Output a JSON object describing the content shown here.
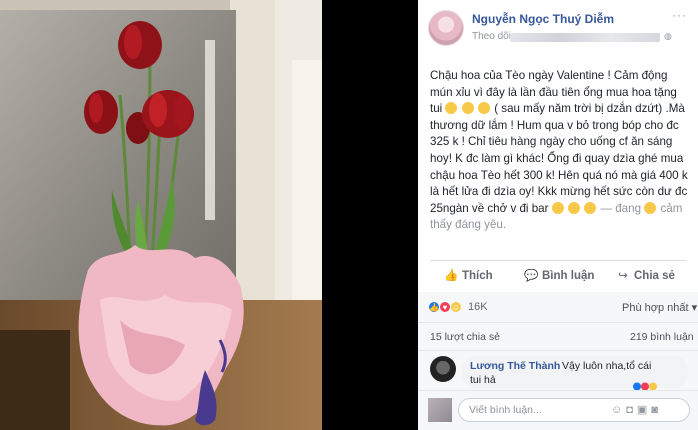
{
  "post": {
    "author": "Nguyễn Ngọc Thuý Diễm",
    "follow_label": "Theo dõi",
    "follow_sep": "·",
    "privacy_icon": "globe-icon",
    "more_icon": "more-icon",
    "text": "Chậu hoa của Tèo ngày Valentine ! Cảm động mún xỉu vì đây là lần đầu tiên ổng mua hoa tặng tui",
    "text2": "( sau mấy năm trời bị dzắn dzứt) .Mà thương dữ lắm ! Hum qua v bỏ trong bóp cho đc 325 k ! Chỉ tiêu hàng ngày cho uống cf ăn sáng hoy! K đc làm gì khác! Ổng đi quay dzìa ghé mua chậu hoa Tèo hết 300 k! Hên quá nó mà giá 400 k là hết lửa đi dzìa oy! Kkk mừng hết sức còn dư đc 25ngàn về chở v đi bar",
    "feeling_prefix": "— đang",
    "feeling_text": "cảm thấy đáng yêu."
  },
  "actions": {
    "like": "Thích",
    "comment": "Bình luận",
    "share": "Chia sẻ"
  },
  "reactions": {
    "count": "16K",
    "sort_label": "Phù hợp nhất",
    "sort_icon": "chevron-down-icon",
    "colors": {
      "like": "#1877f2",
      "love": "#f33e58",
      "haha": "#f7c948"
    }
  },
  "stats": {
    "shares": "15 lượt chia sẻ",
    "comments": "219 bình luận"
  },
  "top_comment": {
    "name": "Lương Thế Thành",
    "text": "Vậy luôn nha,tổ cái",
    "text2": "tui hả"
  },
  "composer": {
    "placeholder": "Viết bình luận..."
  }
}
